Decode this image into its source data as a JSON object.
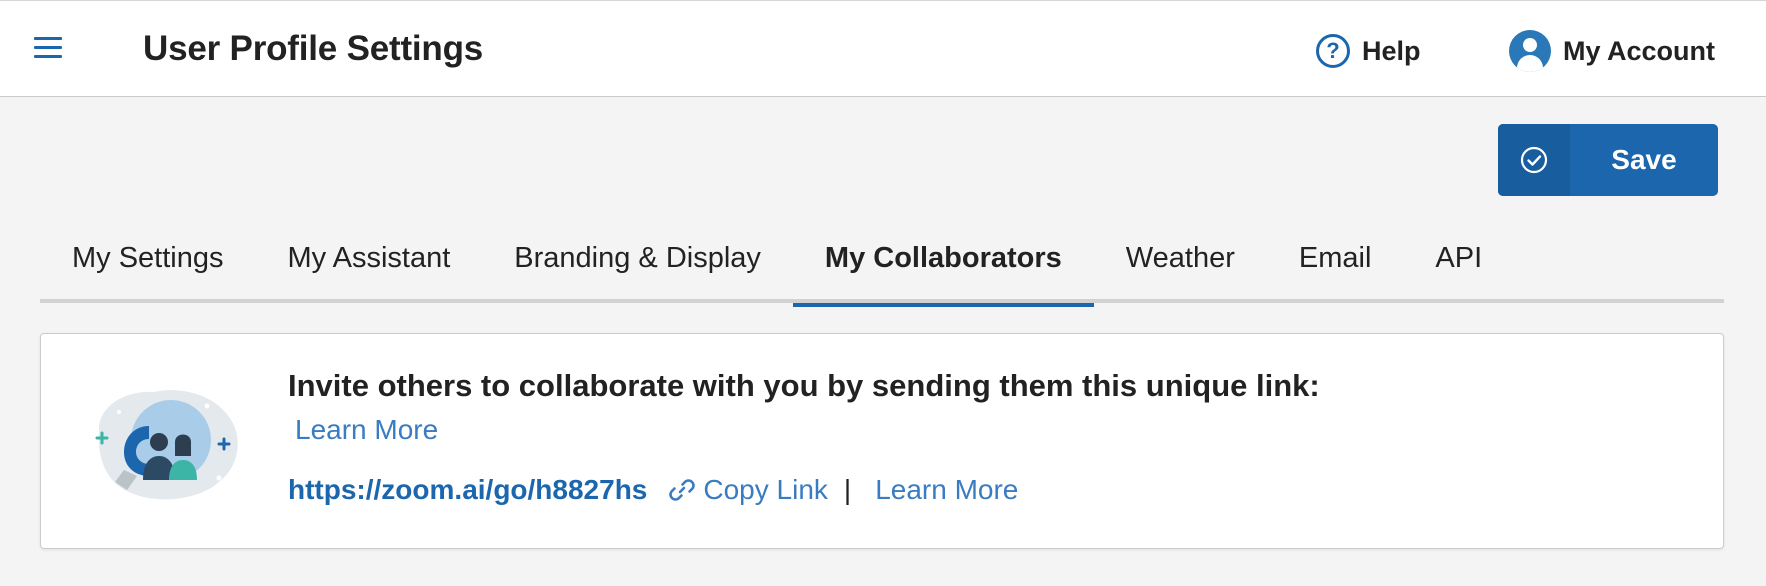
{
  "header": {
    "menu_icon": "hamburger-menu-icon",
    "title": "User Profile Settings",
    "help_label": "Help",
    "help_icon": "question-circle-icon",
    "account_label": "My Account",
    "account_icon": "user-avatar-icon"
  },
  "toolbar": {
    "save_label": "Save",
    "save_icon": "check-circle-icon"
  },
  "tabs": [
    {
      "label": "My Settings",
      "active": false
    },
    {
      "label": "My Assistant",
      "active": false
    },
    {
      "label": "Branding & Display",
      "active": false
    },
    {
      "label": "My Collaborators",
      "active": true
    },
    {
      "label": "Weather",
      "active": false
    },
    {
      "label": "Email",
      "active": false
    },
    {
      "label": "API",
      "active": false
    }
  ],
  "collaborators": {
    "illustration_icon": "collaborators-magnet-illustration",
    "invite_text": "Invite others to collaborate with you by sending them this unique link:",
    "learn_more_label": "Learn More",
    "link_url": "https://zoom.ai/go/h8827hs",
    "copy_link_label": "Copy Link",
    "copy_link_icon": "chain-link-icon",
    "separator": "|",
    "learn_more_label_2": "Learn More"
  },
  "colors": {
    "accent": "#1b66ad",
    "link": "#3a7cc1",
    "background": "#f4f4f4"
  }
}
